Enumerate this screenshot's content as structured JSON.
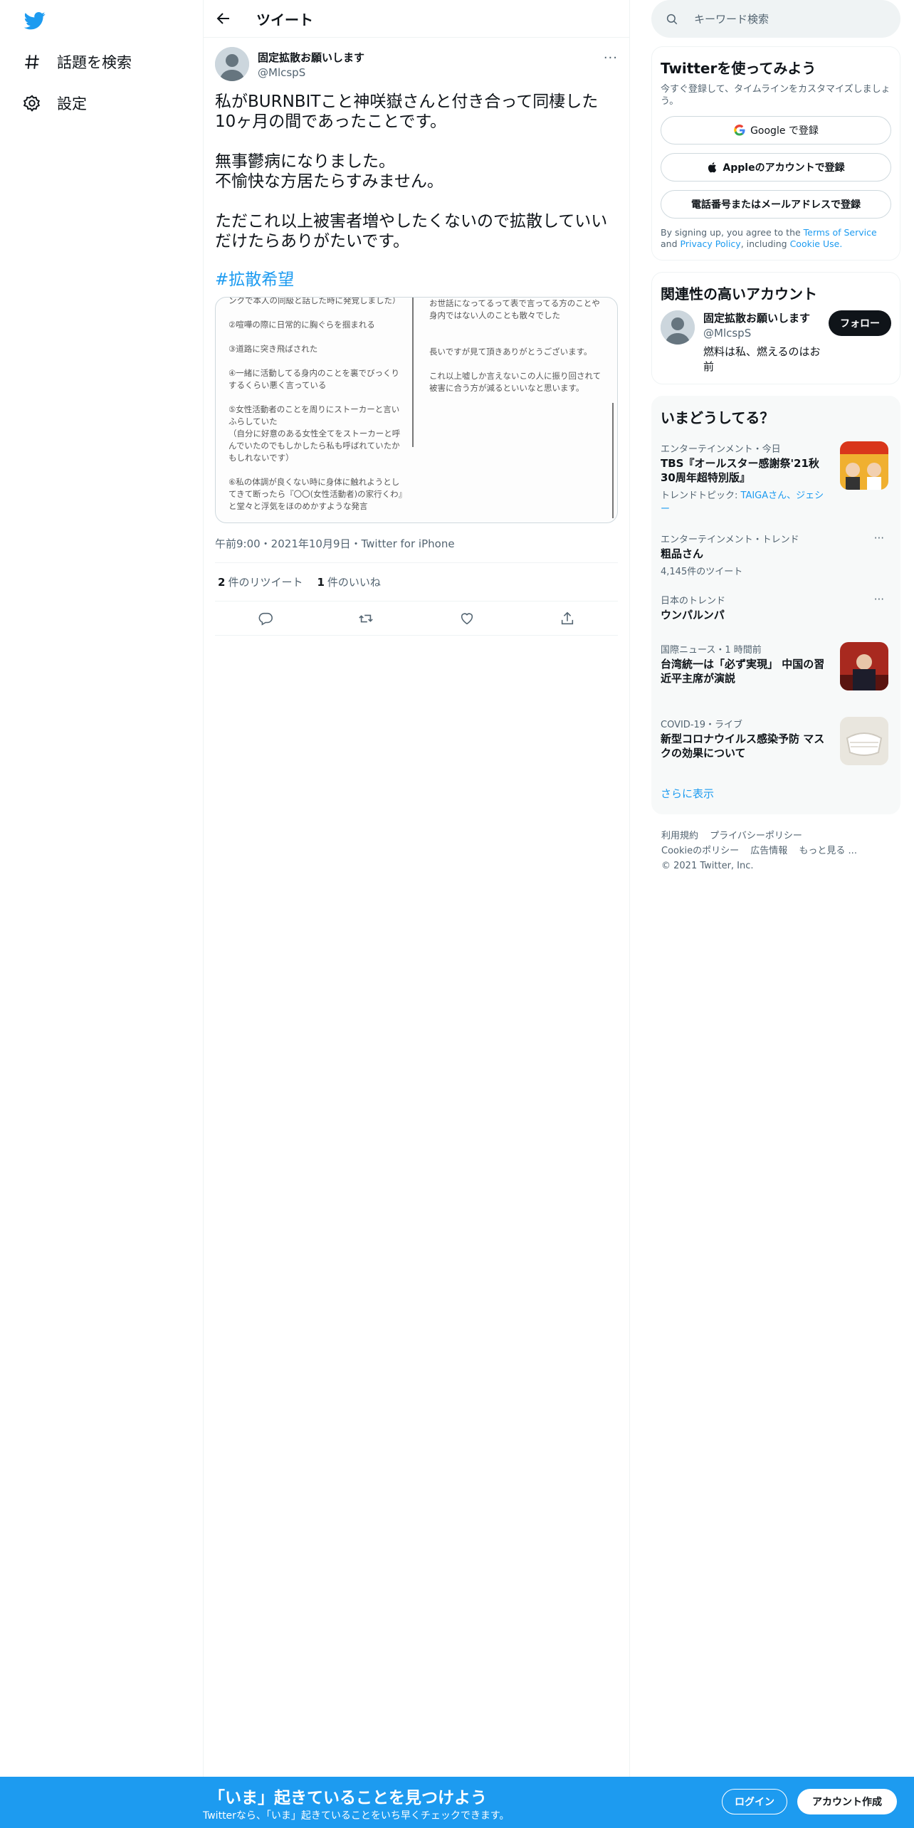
{
  "nav": {
    "explore_label": "話題を検索",
    "settings_label": "設定"
  },
  "header": {
    "title": "ツイート"
  },
  "tweet": {
    "author_name": "固定拡散お願いします",
    "author_handle": "@MlcspS",
    "more_label": "···",
    "text": "私がBURNBITこと神咲嶽さんと付き合って同棲した10ヶ月の間であったことです。\n\n無事鬱病になりました。\n不愉快な方居たらすみません。\n\nただこれ以上被害者増やしたくないので拡散していいだけたらありがたいです。",
    "hashtag": "#拡散希望",
    "media_left_text": "ンクで本人の同級と話した時に発覚しました）\n\n②喧嘩の際に日常的に胸ぐらを掴まれる\n\n③道路に突き飛ばされた\n\n④一緒に活動してる身内のことを裏でびっくりするくらい悪く言っている\n\n⑤女性活動者のことを周りにストーカーと言いふらしていた\n（自分に好意のある女性全てをストーカーと呼んでいたのでもしかしたら私も呼ばれていたかもしれないです）\n\n⑥私の体調が良くない時に身体に触れようとしてきて断ったら『〇〇(女性活動者)の家行くわ』と堂々と浮気をほのめかすような発言",
    "media_right_text": "お世話になってるって表で言ってる方のことや身内ではない人のことも散々でした\n\n\n長いですが見て頂きありがとうございます。\n\nこれ以上嘘しか言えないこの人に振り回されて被害に合う方が減るといいなと思います。",
    "meta": "午前9:00・2021年10月9日・Twitter for iPhone",
    "retweet_count": "2",
    "retweet_label": "件のリツイート",
    "like_count": "1",
    "like_label": "件のいいね"
  },
  "search": {
    "placeholder": "キーワード検索"
  },
  "signup_panel": {
    "title": "Twitterを使ってみよう",
    "desc": "今すぐ登録して、タイムラインをカスタマイズしましょう。",
    "google_label": "Google で登録",
    "apple_label": "Appleのアカウントで登録",
    "phone_label": "電話番号またはメールアドレスで登録",
    "terms_prefix": "By signing up, you agree to the",
    "terms_tos": "Terms of Service",
    "terms_and": "and",
    "terms_privacy": "Privacy Policy",
    "terms_including": ", including",
    "terms_cookie": "Cookie Use."
  },
  "related_panel": {
    "title": "関連性の高いアカウント",
    "name": "固定拡散お願いします",
    "handle": "@MlcspS",
    "bio": "燃料は私、燃えるのはお前",
    "follow_label": "フォロー"
  },
  "trends_panel": {
    "title": "いまどうしてる？",
    "items": [
      {
        "meta": "エンターテインメント・今日",
        "title": "TBS『オールスター感謝祭'21秋 30周年超特別版』",
        "sub_prefix": "トレンドトピック: ",
        "sub_links": "TAIGAさん、ジェシー"
      },
      {
        "meta": "エンターテインメント・トレンド",
        "title": "粗品さん",
        "sub": "4,145件のツイート"
      },
      {
        "meta": "日本のトレンド",
        "title": "ウンパルンパ"
      },
      {
        "meta": "国際ニュース・1 時間前",
        "title": "台湾統一は「必ず実現」 中国の習近平主席が演説"
      },
      {
        "meta": "COVID-19・ライブ",
        "title": "新型コロナウイルス感染予防 マスクの効果について"
      }
    ],
    "show_more": "さらに表示"
  },
  "footer": {
    "terms": "利用規約",
    "privacy": "プライバシーポリシー",
    "cookie": "Cookieのポリシー",
    "ads": "広告情報",
    "more": "もっと見る ...",
    "copyright": "© 2021 Twitter, Inc."
  },
  "bottom_bar": {
    "title": "「いま」起きていることを見つけよう",
    "subtitle": "Twitterなら、「いま」起きていることをいち早くチェックできます。",
    "login_label": "ログイン",
    "signup_label": "アカウント作成"
  },
  "colors": {
    "accent": "#1d9bf0",
    "text": "#0f1419",
    "secondary": "#536471"
  }
}
